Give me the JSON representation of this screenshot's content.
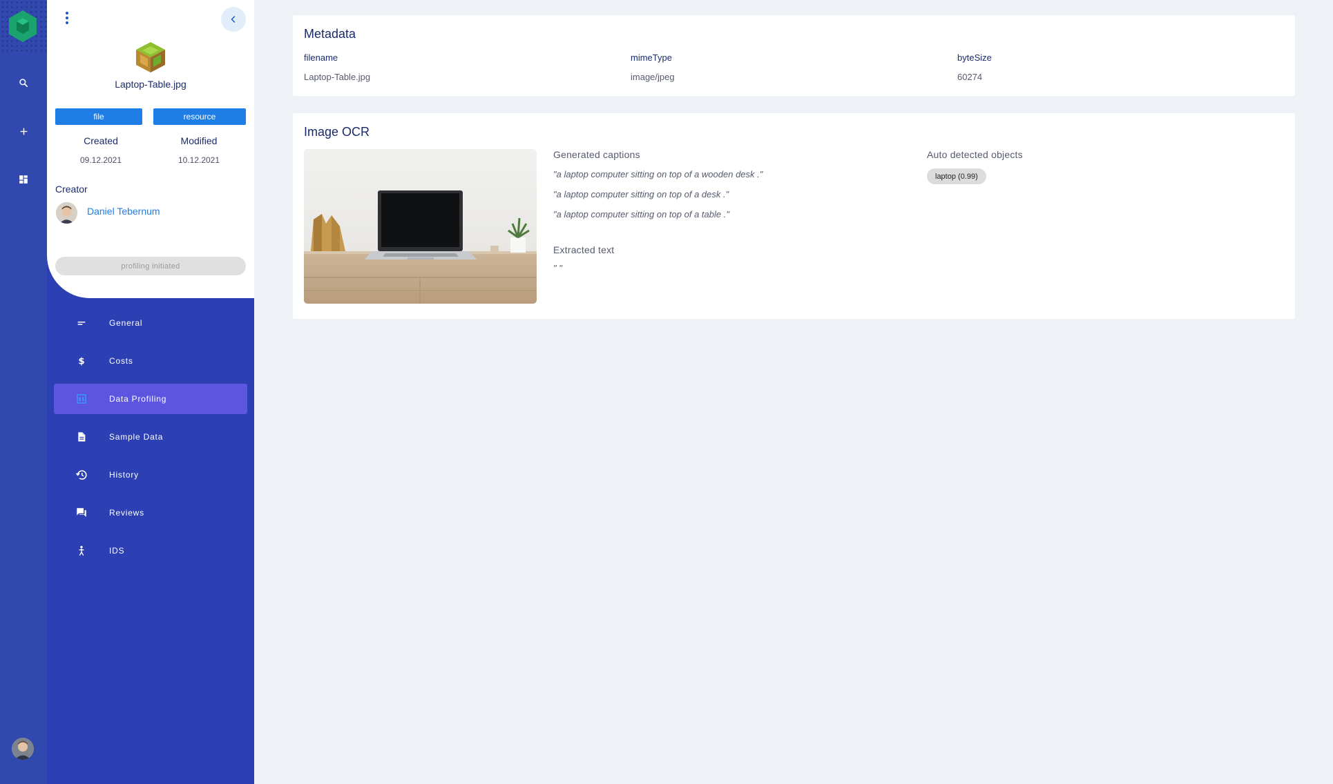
{
  "colors": {
    "rail": "#3148ae",
    "sidebar": "#2d40b3",
    "active_nav": "#5b55e0",
    "tag_bg": "#1e7ee6",
    "logo": "#1aa36f",
    "page_bg": "#eef2f7"
  },
  "rail": {
    "icons": [
      "search-icon",
      "plus-icon",
      "dashboard-icon"
    ]
  },
  "sidebar": {
    "file_name": "Laptop-Table.jpg",
    "tags": [
      "file",
      "resource"
    ],
    "created_label": "Created",
    "created_value": "09.12.2021",
    "modified_label": "Modified",
    "modified_value": "10.12.2021",
    "creator_label": "Creator",
    "creator_name": "Daniel Tebernum",
    "status": "profiling initiated",
    "nav": [
      {
        "label": "General",
        "icon": "short-text-icon"
      },
      {
        "label": "Costs",
        "icon": "dollar-icon"
      },
      {
        "label": "Data Profiling",
        "icon": "table-chart-icon",
        "active": true
      },
      {
        "label": "Sample Data",
        "icon": "document-icon"
      },
      {
        "label": "History",
        "icon": "history-icon"
      },
      {
        "label": "Reviews",
        "icon": "forum-icon"
      },
      {
        "label": "IDS",
        "icon": "ids-icon"
      }
    ]
  },
  "metadata": {
    "title": "Metadata",
    "columns": [
      {
        "key": "filename",
        "value": "Laptop-Table.jpg"
      },
      {
        "key": "mimeType",
        "value": "image/jpeg"
      },
      {
        "key": "byteSize",
        "value": "60274"
      }
    ]
  },
  "ocr": {
    "title": "Image OCR",
    "captions_label": "Generated captions",
    "captions": [
      "\"a laptop computer sitting on top of a wooden desk .\"",
      "\"a laptop computer sitting on top of a desk .\"",
      "\"a laptop computer sitting on top of a table .\""
    ],
    "extracted_label": "Extracted text",
    "extracted_text": "\"   \"",
    "objects_label": "Auto detected objects",
    "objects": [
      "laptop (0.99)"
    ]
  }
}
